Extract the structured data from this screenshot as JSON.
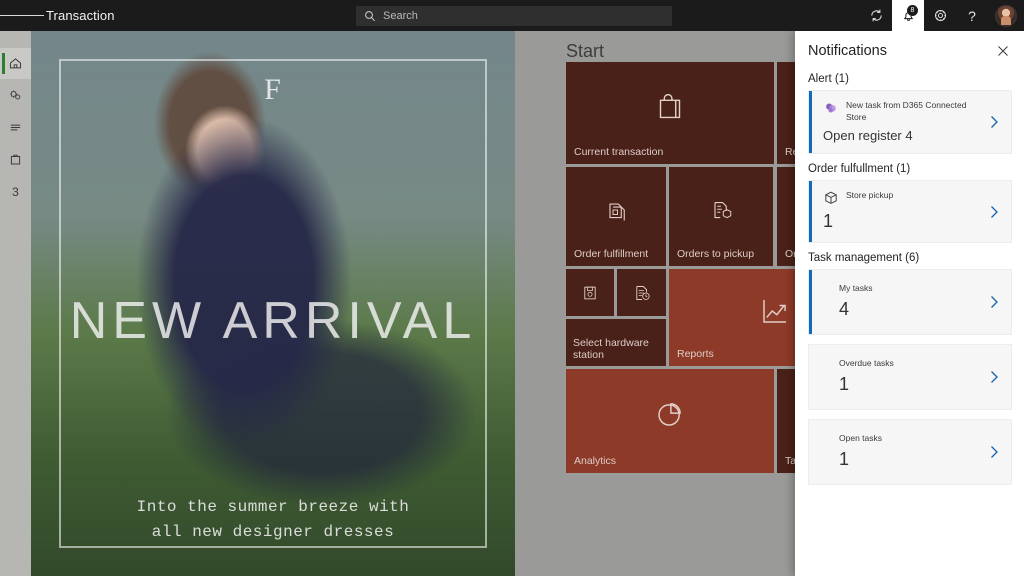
{
  "topbar": {
    "menu_icon": "hamburger-icon",
    "title": "Transaction",
    "search": {
      "placeholder": "Search",
      "value": "",
      "icon": "search-icon"
    },
    "actions": {
      "refresh_icon": "refresh-icon",
      "notifications_icon": "bell-icon",
      "notifications_badge": "8",
      "settings_icon": "gear-icon",
      "help_label": "?",
      "avatar_icon": "user-avatar"
    }
  },
  "rail": {
    "items": [
      {
        "icon": "home-icon",
        "label": "Home",
        "selected": true
      },
      {
        "icon": "settings-gears-icon",
        "label": "Operations",
        "selected": false
      },
      {
        "icon": "list-lines-icon",
        "label": "Lists",
        "selected": false
      },
      {
        "icon": "briefcase-icon",
        "label": "Inventory",
        "selected": false
      },
      {
        "icon": "count-badge",
        "label": "3",
        "selected": false
      }
    ]
  },
  "promo": {
    "logo": "F",
    "headline": "NEW ARRIVAL",
    "subtitle_line1": "Into the summer breeze with",
    "subtitle_line2": "all new designer dresses"
  },
  "start": {
    "title": "Start",
    "tiles": [
      {
        "label": "Current transaction",
        "icon": "shopping-bag-icon",
        "shade": "dark"
      },
      {
        "label": "Return with receipt",
        "icon": "receipt-return-icon",
        "shade": "dark"
      },
      {
        "label": "Order fulfillment",
        "icon": "document-copy-icon",
        "shade": "dark"
      },
      {
        "label": "Orders to pickup",
        "icon": "document-package-icon",
        "shade": "dark"
      },
      {
        "label": "Orders to ship",
        "icon": "document-ship-icon",
        "shade": "dark"
      },
      {
        "label": "",
        "icon": "cash-drawer-icon",
        "shade": "dark"
      },
      {
        "label": "",
        "icon": "document-clock-icon",
        "shade": "dark"
      },
      {
        "label": "Select hardware station",
        "icon": "",
        "shade": "dark"
      },
      {
        "label": "Reports",
        "icon": "trend-chart-icon",
        "shade": "light"
      },
      {
        "label": "Analytics",
        "icon": "pie-chart-icon",
        "shade": "light"
      },
      {
        "label": "Task management",
        "icon": "task-icon",
        "shade": "dark"
      }
    ]
  },
  "notifications": {
    "title": "Notifications",
    "close_icon": "close-icon",
    "groups": [
      {
        "title": "Alert (1)",
        "cards": [
          {
            "icon": "d365-connected-store-icon",
            "subtitle": "New task from D365 Connected Store",
            "value": "Open register 4",
            "value_style": "text",
            "accent": true,
            "chevron": "chevron-right-icon"
          }
        ]
      },
      {
        "title": "Order fulfullment (1)",
        "cards": [
          {
            "icon": "package-box-icon",
            "subtitle": "Store pickup",
            "value": "1",
            "value_style": "number",
            "accent": true,
            "chevron": "chevron-right-icon"
          }
        ]
      },
      {
        "title": "Task management (6)",
        "cards": [
          {
            "icon": "",
            "subtitle": "My tasks",
            "value": "4",
            "value_style": "number",
            "accent": true,
            "chevron": "chevron-right-icon"
          },
          {
            "icon": "",
            "subtitle": "Overdue tasks",
            "value": "1",
            "value_style": "number",
            "accent": false,
            "chevron": "chevron-right-icon"
          },
          {
            "icon": "",
            "subtitle": "Open tasks",
            "value": "1",
            "value_style": "number",
            "accent": false,
            "chevron": "chevron-right-icon"
          }
        ]
      }
    ]
  },
  "colors": {
    "tile_dark": "#4a2118",
    "tile_light": "#8e3a28",
    "accent_blue": "#0f6cbd",
    "rail_selected": "#2f7d32",
    "chrome_dark": "#1b1b1b"
  }
}
